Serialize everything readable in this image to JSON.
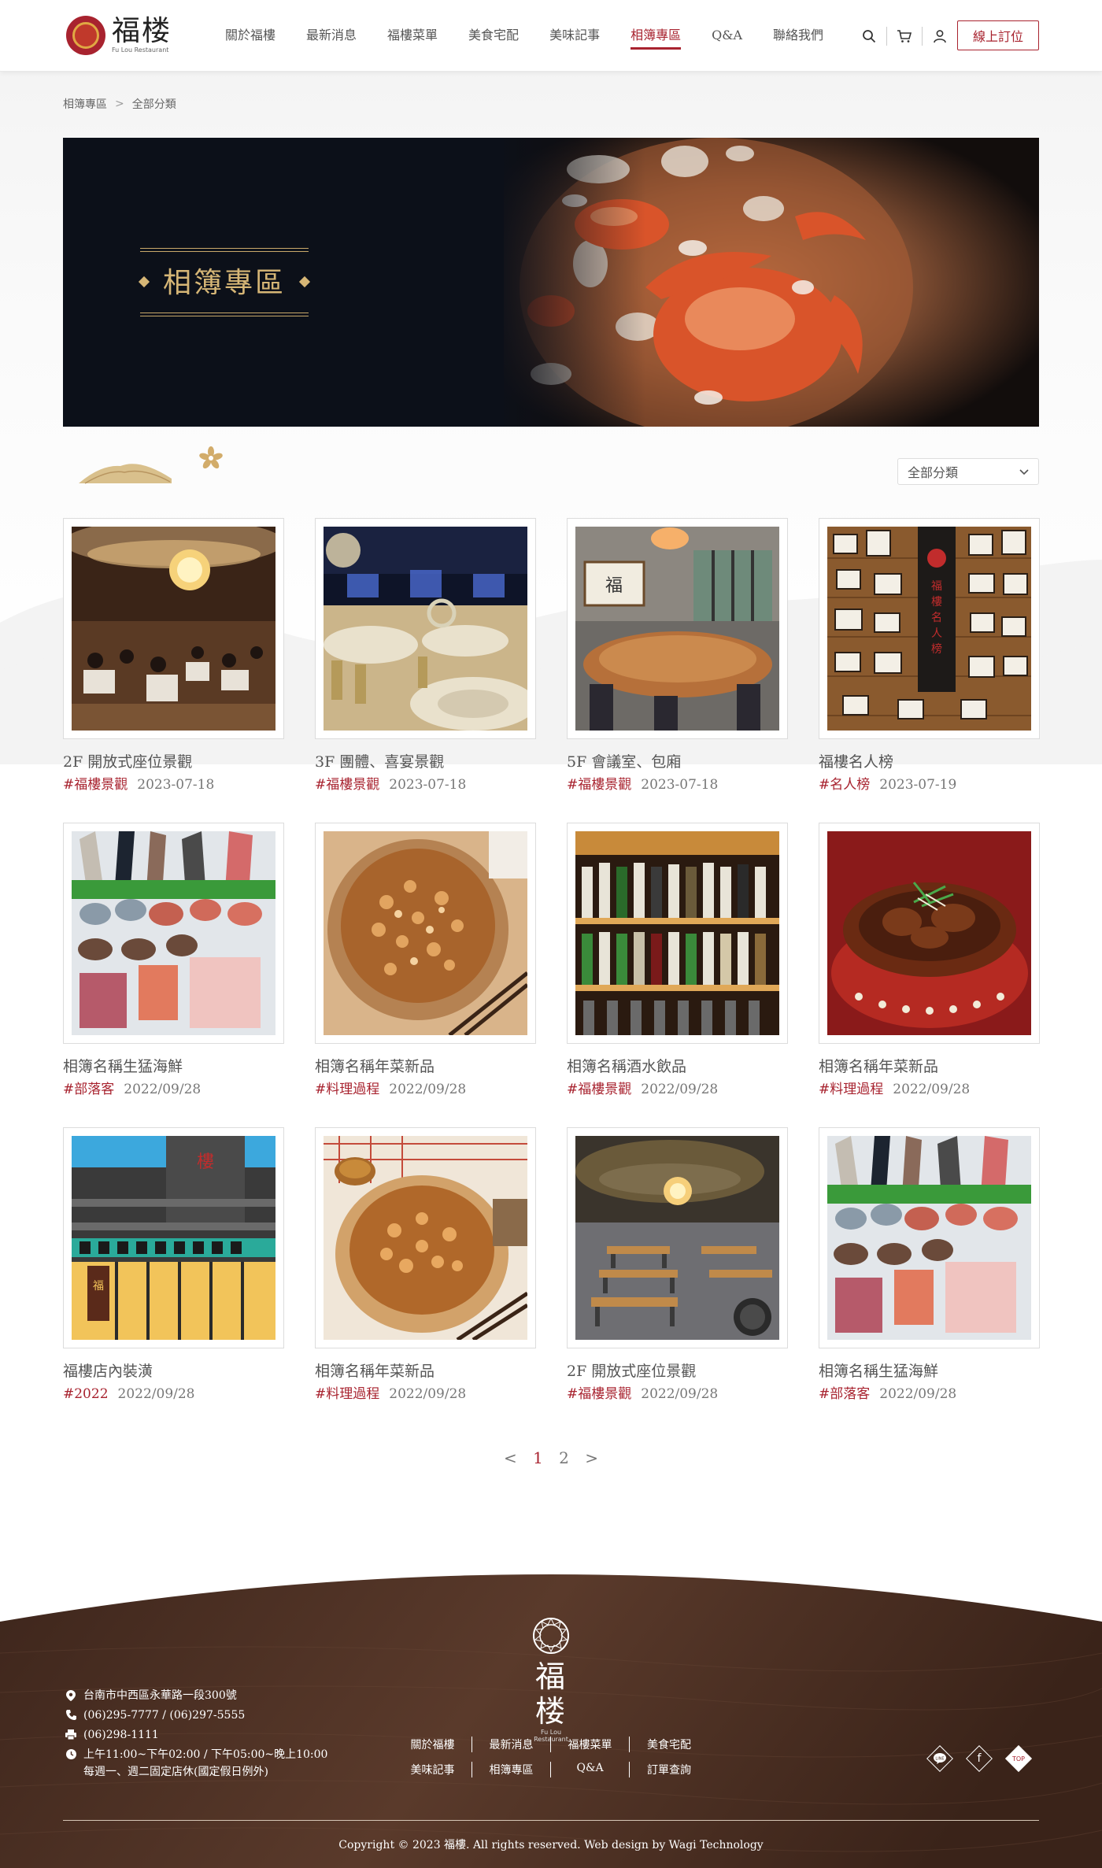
{
  "header": {
    "logo_text": "福楼",
    "logo_sub": "Fu Lou Restaurant",
    "nav": [
      "關於福樓",
      "最新消息",
      "福樓菜單",
      "美食宅配",
      "美味記事",
      "相簿專區",
      "Q&A",
      "聯絡我們"
    ],
    "active_nav": "相簿專區",
    "book_label": "線上訂位",
    "icons": [
      "search-icon",
      "cart-icon",
      "user-icon"
    ]
  },
  "breadcrumb": [
    "相簿專區",
    "全部分類"
  ],
  "banner": {
    "title": "相簿專區"
  },
  "category_select": {
    "value": "全部分類"
  },
  "albums": [
    {
      "title": "2F 開放式座位景觀",
      "tag": "#福樓景觀",
      "date": "2023-07-18",
      "scene": "dining-hall"
    },
    {
      "title": "3F 團體、喜宴景觀",
      "tag": "#福樓景觀",
      "date": "2023-07-18",
      "scene": "banquet"
    },
    {
      "title": "5F 會議室、包廂",
      "tag": "#福樓景觀",
      "date": "2023-07-18",
      "scene": "private-room"
    },
    {
      "title": "福樓名人榜",
      "tag": "#名人榜",
      "date": "2023-07-19",
      "scene": "celebrity-wall"
    },
    {
      "title": "相簿名稱生猛海鮮",
      "tag": "#部落客",
      "date": "2022/09/28",
      "scene": "seafood"
    },
    {
      "title": "相簿名稱年菜新品",
      "tag": "#料理過程",
      "date": "2022/09/28",
      "scene": "rice-dish"
    },
    {
      "title": "相簿名稱酒水飲品",
      "tag": "#福樓景觀",
      "date": "2022/09/28",
      "scene": "wine-shelf"
    },
    {
      "title": "相簿名稱年菜新品",
      "tag": "#料理過程",
      "date": "2022/09/28",
      "scene": "braised-dish"
    },
    {
      "title": "福樓店內裝潢",
      "tag": "#2022",
      "date": "2022/09/28",
      "scene": "storefront"
    },
    {
      "title": "相簿名稱年菜新品",
      "tag": "#料理過程",
      "date": "2022/09/28",
      "scene": "rice-dish-2"
    },
    {
      "title": "2F 開放式座位景觀",
      "tag": "#福樓景觀",
      "date": "2022/09/28",
      "scene": "dining-hall-2"
    },
    {
      "title": "相簿名稱生猛海鮮",
      "tag": "#部落客",
      "date": "2022/09/28",
      "scene": "seafood"
    }
  ],
  "pagination": {
    "prev": "<",
    "pages": [
      "1",
      "2"
    ],
    "current": "1",
    "next": ">"
  },
  "footer": {
    "logo_text": "福楼",
    "logo_sub": "Fu Lou Restaurant",
    "address": "台南市中西區永華路一段300號",
    "phone": "(06)295-7777 / (06)297-5555",
    "fax": "(06)298-1111",
    "hours": "上午11:00~下午02:00 / 下午05:00~晚上10:00",
    "closed": "每週一、週二固定店休(國定假日例外)",
    "links_row1": [
      "關於福樓",
      "最新消息",
      "福樓菜單",
      "美食宅配"
    ],
    "links_row2": [
      "美味記事",
      "相簿專區",
      "Q&A",
      "訂單查詢"
    ],
    "social": [
      "line-icon",
      "facebook-icon"
    ],
    "top_label": "TOP",
    "copyright": "Copyright © 2023 福樓. All rights reserved. Web design by Wagi Technology"
  },
  "colors": {
    "brand": "#a8232f",
    "gold": "#d6b676",
    "footer_wood": "#4a2e22"
  }
}
